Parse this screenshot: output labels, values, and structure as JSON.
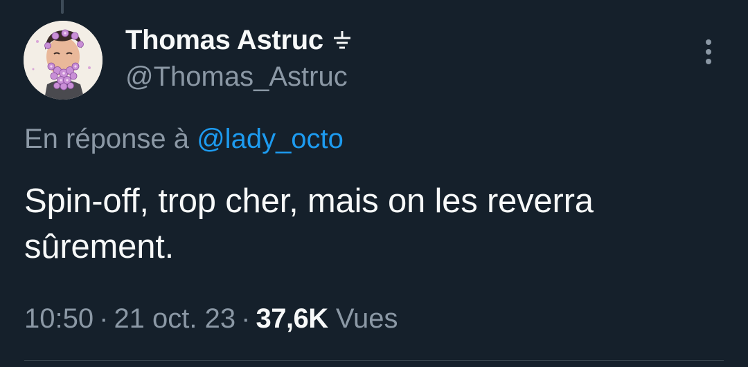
{
  "author": {
    "display_name": "Thomas Astruc",
    "handle": "@Thomas_Astruc",
    "badge_icon": "ground-symbol-icon",
    "avatar_icon": "cartoon-avatar-flower-beard"
  },
  "reply": {
    "prefix": "En réponse à",
    "target": "@lady_octo"
  },
  "tweet": {
    "text": "Spin-off, trop cher, mais on les reverra sûrement."
  },
  "meta": {
    "time": "10:50",
    "date": "21 oct. 23",
    "separator": "·",
    "views_count": "37,6K",
    "views_label": "Vues"
  },
  "menu": {
    "more_icon": "more-vertical-icon"
  },
  "colors": {
    "background": "#15202b",
    "text_primary": "#f7f9f9",
    "text_secondary": "#8b98a5",
    "link": "#1d9bf0",
    "divider": "#38444d"
  }
}
